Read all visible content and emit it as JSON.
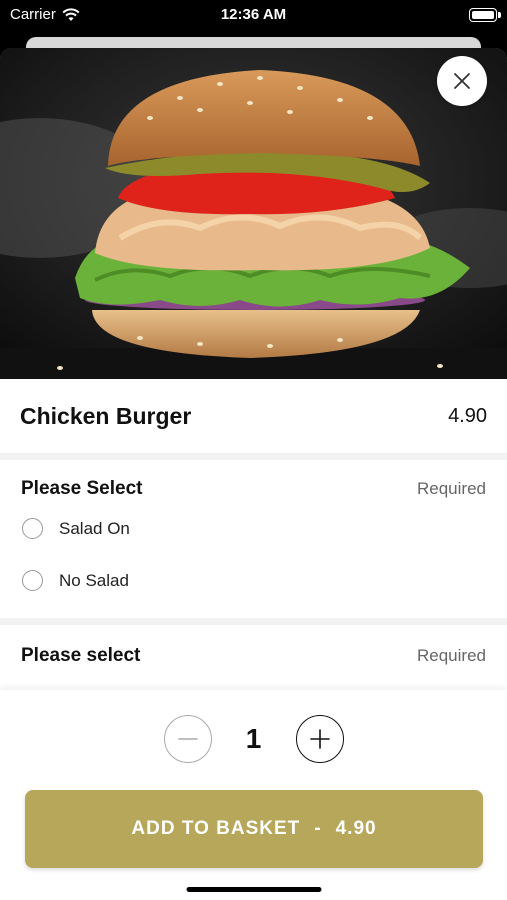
{
  "status_bar": {
    "carrier": "Carrier",
    "time": "12:36 AM"
  },
  "product": {
    "name": "Chicken Burger",
    "price": "4.90",
    "image": "chicken-burger-photo"
  },
  "sections": [
    {
      "label": "Please Select",
      "status": "Required",
      "options": [
        {
          "label": "Salad On"
        },
        {
          "label": "No Salad"
        }
      ]
    },
    {
      "label": "Please select",
      "status": "Required",
      "options": []
    }
  ],
  "quantity": {
    "value": "1"
  },
  "add_button": {
    "label": "ADD TO BASKET",
    "separator": "-",
    "price": "4.90"
  },
  "colors": {
    "accent": "#b6a75a",
    "background": "#ffffff"
  },
  "icons": {
    "close": "close-icon",
    "minus": "minus-icon",
    "plus": "plus-icon",
    "wifi": "wifi-icon",
    "battery": "battery-icon"
  }
}
